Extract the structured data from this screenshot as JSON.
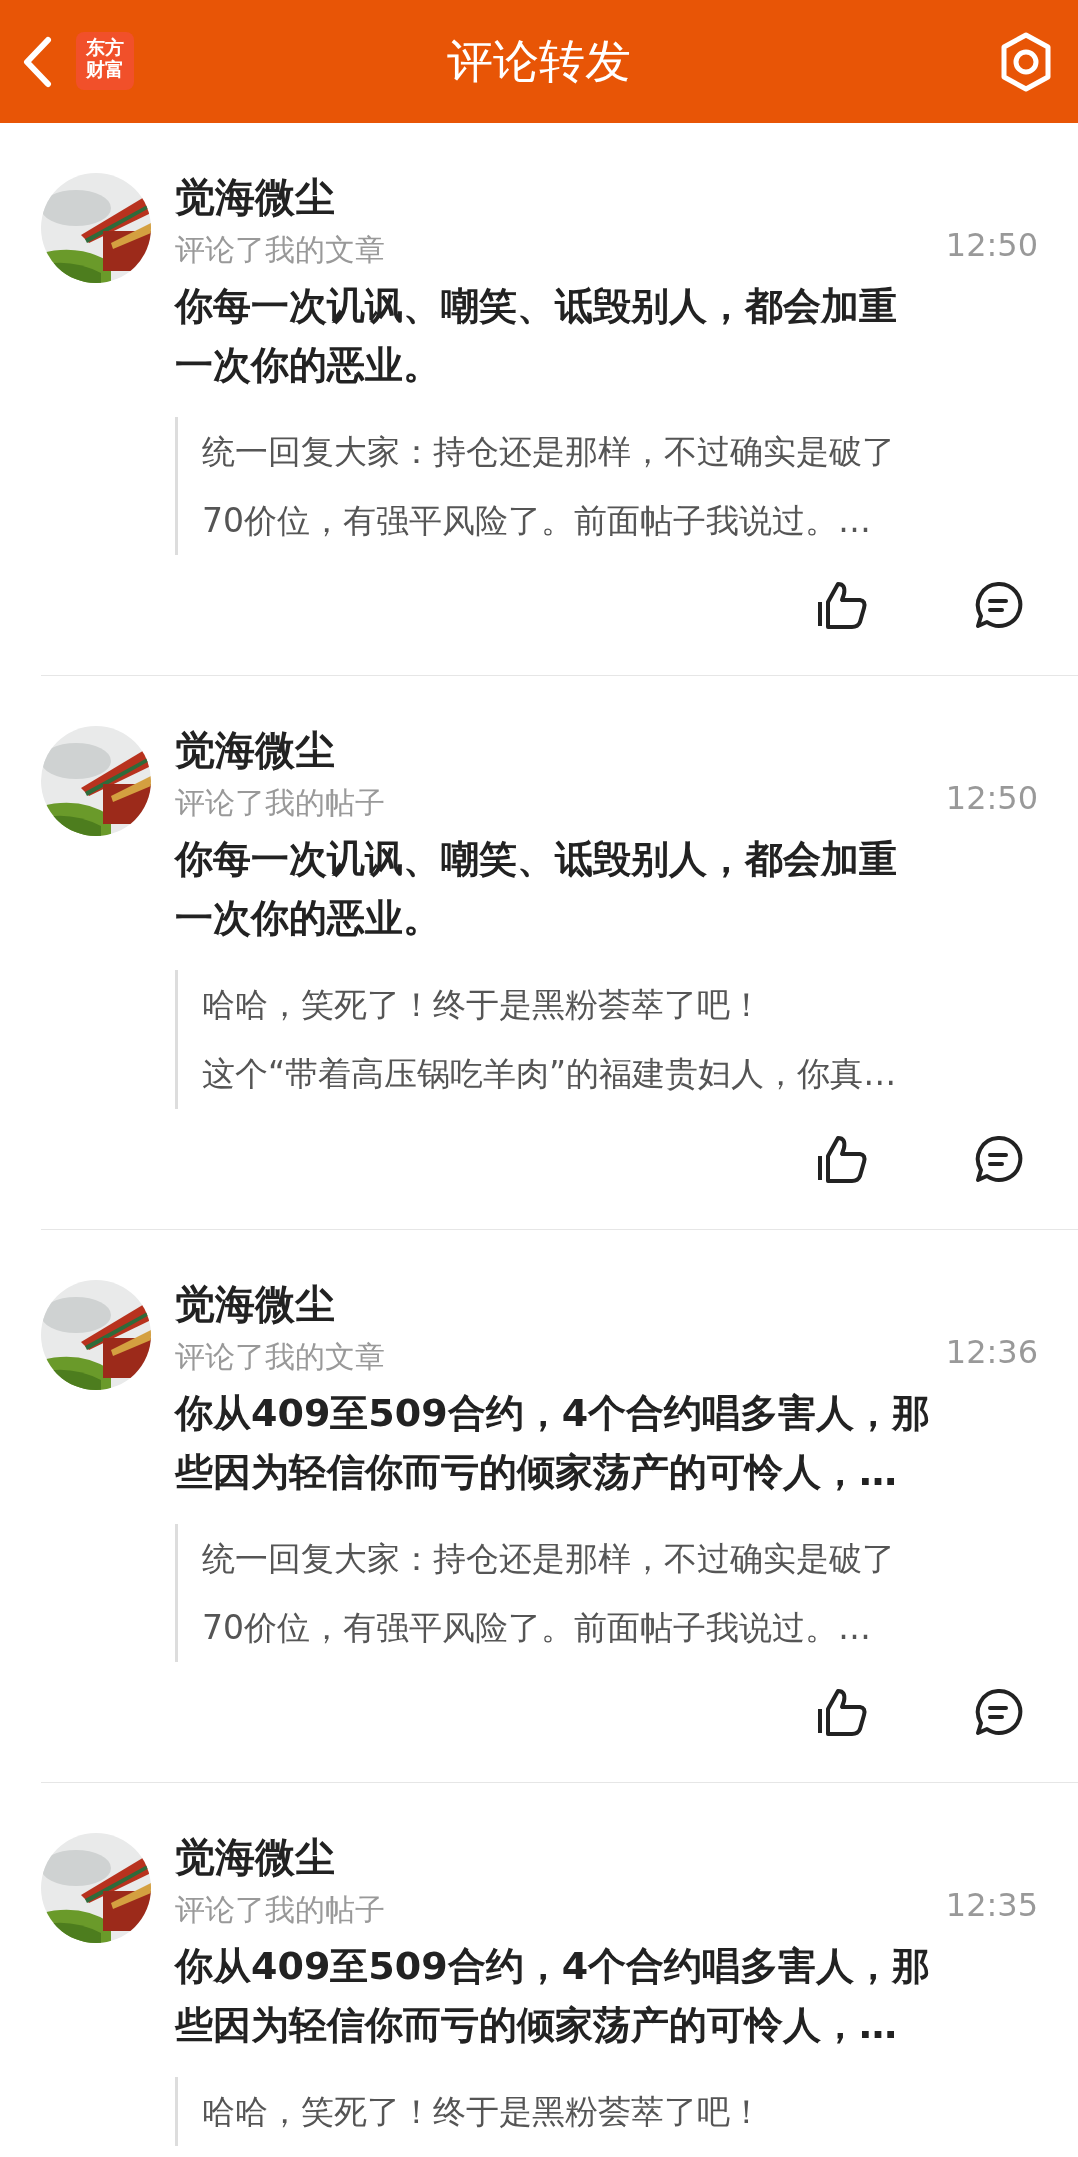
{
  "header": {
    "title": "评论转发",
    "logo_lines": [
      "东方",
      "财富"
    ]
  },
  "items": [
    {
      "name": "觉海微尘",
      "action": "评论了我的文章",
      "time": "12:50",
      "content": [
        "你每一次讥讽、嘲笑、诋毁别人，都会加重",
        "一次你的恶业。"
      ],
      "quote": [
        "统一回复大家：持仓还是那样，不过确实是破了",
        "70价位，有强平风险了。前面帖子我说过。…"
      ],
      "actions_visible": true
    },
    {
      "name": "觉海微尘",
      "action": "评论了我的帖子",
      "time": "12:50",
      "content": [
        "你每一次讥讽、嘲笑、诋毁别人，都会加重",
        "一次你的恶业。"
      ],
      "quote": [
        "哈哈，笑死了！终于是黑粉荟萃了吧！",
        "这个“带着高压锅吃羊肉”的福建贵妇人，你真…"
      ],
      "actions_visible": true
    },
    {
      "name": "觉海微尘",
      "action": "评论了我的文章",
      "time": "12:36",
      "content": [
        "你从409至509合约，4个合约唱多害人，那",
        "些因为轻信你而亏的倾家荡产的可怜人，…"
      ],
      "quote": [
        "统一回复大家：持仓还是那样，不过确实是破了",
        "70价位，有强平风险了。前面帖子我说过。…"
      ],
      "actions_visible": true
    },
    {
      "name": "觉海微尘",
      "action": "评论了我的帖子",
      "time": "12:35",
      "content": [
        "你从409至509合约，4个合约唱多害人，那",
        "些因为轻信你而亏的倾家荡产的可怜人，…"
      ],
      "quote": [
        "哈哈，笑死了！终于是黑粉荟萃了吧！"
      ],
      "actions_visible": false
    }
  ]
}
